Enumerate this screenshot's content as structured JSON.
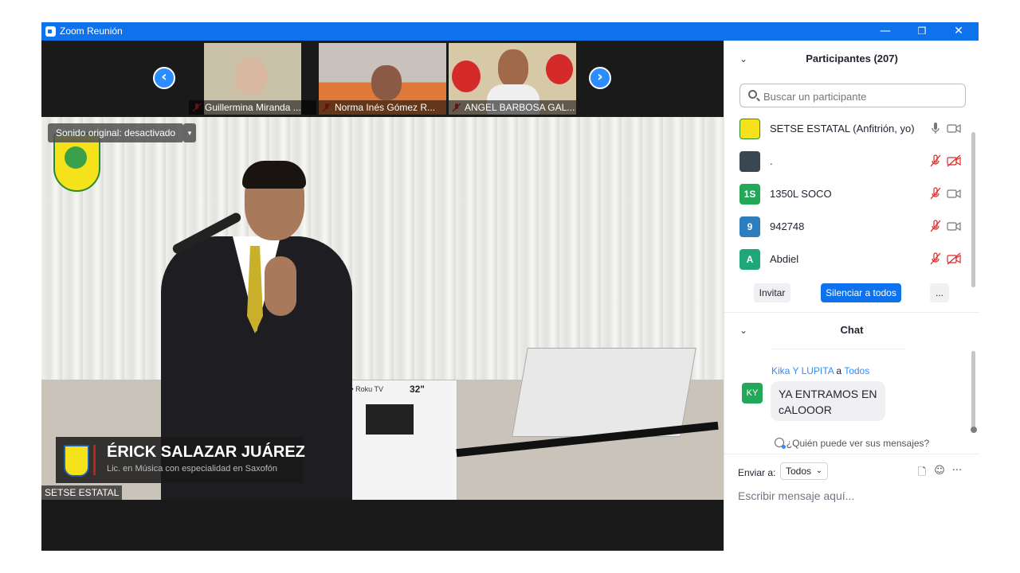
{
  "window": {
    "title": "Zoom Reunión",
    "minimize": "—",
    "restore": "❐",
    "close": "✕"
  },
  "thumbnails": [
    {
      "name": "Guillermina Miranda ..."
    },
    {
      "name": "Norma Inés Gómez R..."
    },
    {
      "name": "ANGEL BARBOSA GAL..."
    }
  ],
  "nav": {
    "prev": "‹",
    "next": "›"
  },
  "main_video": {
    "audio_status": "Sonido original: desactivado",
    "audio_dropdown": "▾",
    "lower_third_name": "ÉRICK SALAZAR JUÁREZ",
    "lower_third_role": "Lic. en Música con especialidad en Saxofón",
    "speaker_tag": "SETSE ESTATAL",
    "tv_brand": "JVC • Roku TV",
    "tv_size": "32\""
  },
  "participants": {
    "title": "Participantes (207)",
    "search_placeholder": "Buscar un participante",
    "list": [
      {
        "name": "SETSE ESTATAL (Anfitrión, yo)",
        "avatar_text": "",
        "avatar_color": "#f5e21b",
        "mic": "on",
        "video": "on"
      },
      {
        "name": ".",
        "avatar_text": "",
        "avatar_color": "#3a4650",
        "mic": "muted",
        "video": "off"
      },
      {
        "name": "1350L SOCO",
        "avatar_text": "1S",
        "avatar_color": "#23a85a",
        "mic": "muted",
        "video": "on"
      },
      {
        "name": "942748",
        "avatar_text": "9",
        "avatar_color": "#2d7ebf",
        "mic": "muted",
        "video": "on"
      },
      {
        "name": "Abdiel",
        "avatar_text": "A",
        "avatar_color": "#1fa67a",
        "mic": "muted",
        "video": "off"
      }
    ],
    "invite_label": "Invitar",
    "mute_all_label": "Silenciar a todos",
    "more_label": "..."
  },
  "chat": {
    "title": "Chat",
    "message": {
      "sender": "Kika Y LUPITA",
      "to_word": "a",
      "recipient": "Todos",
      "avatar_text": "KY",
      "text": "YA ENTRAMOS EN cALOOOR"
    },
    "who_can_see": "¿Quién puede ver sus mensajes?",
    "send_to_label": "Enviar a:",
    "send_to_value": "Todos",
    "compose_placeholder": "Escribir mensaje aquí...",
    "more_label": "···"
  },
  "colors": {
    "accent": "#0e72ed",
    "primary_button": "#0e72ed",
    "muted_red": "#e02828"
  }
}
